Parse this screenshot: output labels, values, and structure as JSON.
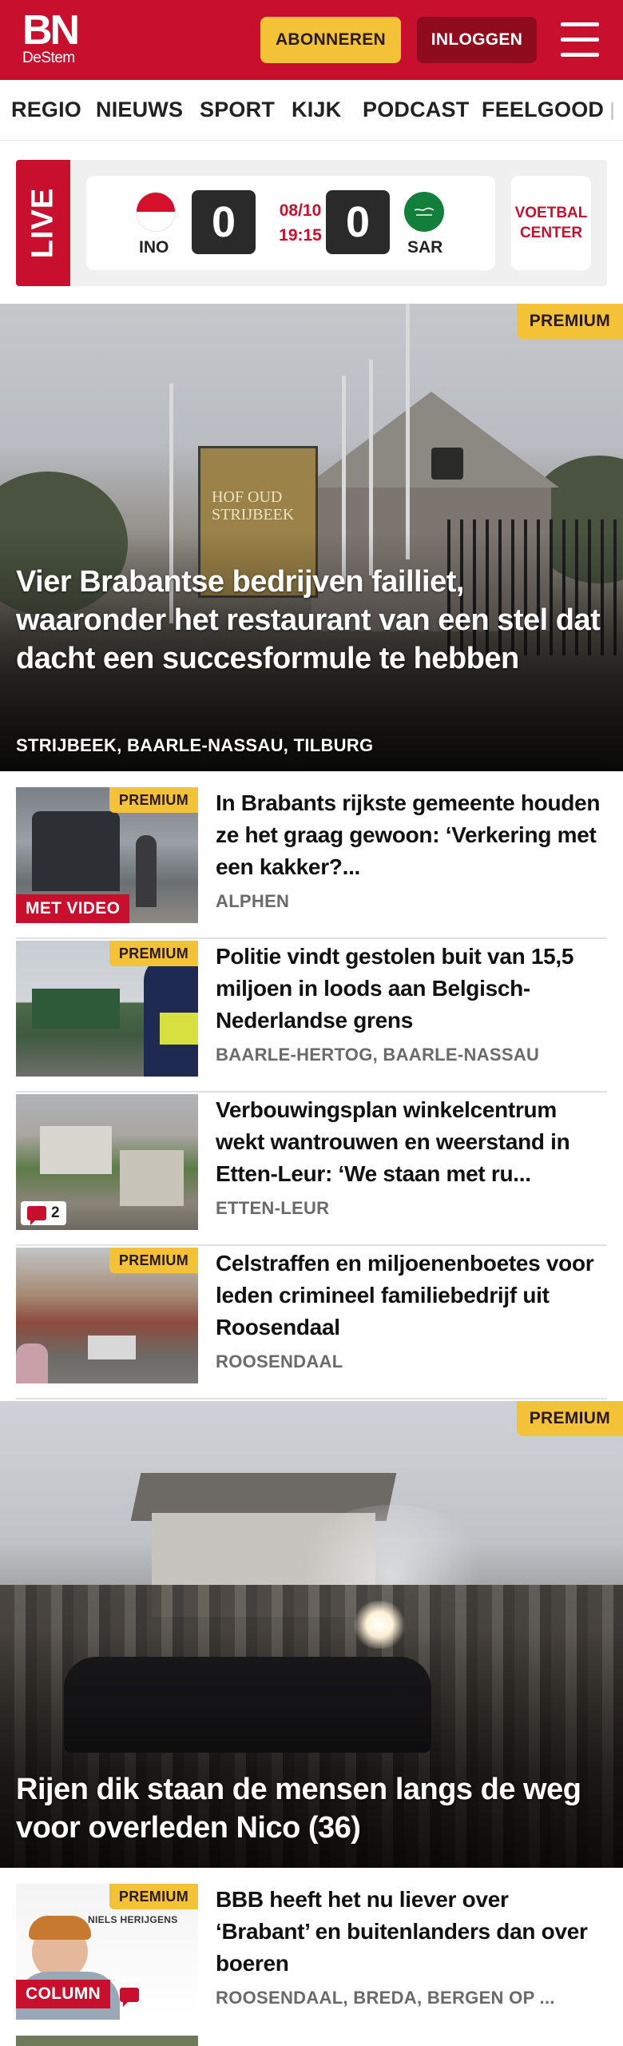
{
  "header": {
    "logo_main": "BN",
    "logo_sub": "DeStem",
    "subscribe_label": "ABONNEREN",
    "login_label": "INLOGGEN",
    "menu_icon": "hamburger-icon"
  },
  "nav": {
    "items": [
      "REGIO",
      "NIEUWS",
      "SPORT",
      "KIJK",
      "PODCAST",
      "FEELGOOD"
    ]
  },
  "live": {
    "label": "LIVE",
    "home_code": "INO",
    "home_score": "0",
    "date": "08/10",
    "time": "19:15",
    "away_code": "SAR",
    "away_score": "0",
    "center_line1": "VOETBAL",
    "center_line2": "CENTER"
  },
  "hero1": {
    "badge": "PREMIUM",
    "title": "Vier Brabantse bedrijven failliet, waaronder het restaurant van een stel dat dacht een succesformule te hebben",
    "location": "STRIJBEEK, BAARLE-NASSAU, TILBURG",
    "sign_text_1": "HOF OUD",
    "sign_text_2": "STRIJBEEK"
  },
  "articles": [
    {
      "badge": "PREMIUM",
      "tag": "MET VIDEO",
      "title": "In Brabants rijkste gemeente houden ze het graag gewoon: ‘Verkering met een kakker?...",
      "location": "ALPHEN"
    },
    {
      "badge": "PREMIUM",
      "title": "Politie vindt gestolen buit van 15,5 miljoen in loods aan Bel­gisch-Nederlandse grens",
      "location": "BAARLE-HERTOG, BAARLE-NASSAU"
    },
    {
      "comments": "2",
      "title": "Verbouwingsplan winkelcentrum wekt wantrouwen en weerstand in Etten-Leur: ‘We staan met ru...",
      "location": "ETTEN-LEUR"
    },
    {
      "badge": "PREMIUM",
      "title": "Celstraffen en miljoenenboetes voor leden crimineel familiebe­drijf uit Roosendaal",
      "location": "ROOSENDAAL"
    }
  ],
  "hero2": {
    "badge": "PREMIUM",
    "title": "Rijen dik staan de mensen langs de weg voor overleden Nico (36)"
  },
  "column_article": {
    "badge": "PREMIUM",
    "tag": "COLUMN",
    "author": "NIELS HERIJGENS",
    "title": "BBB heeft het nu liever over ‘Brabant’ en buitenlanders dan over boeren",
    "location": "ROOSENDAAL, BREDA, BERGEN OP ..."
  },
  "colors": {
    "brand_red": "#c8102e",
    "premium_yellow": "#f4c236",
    "login_dark_red": "#8f0c1d"
  }
}
